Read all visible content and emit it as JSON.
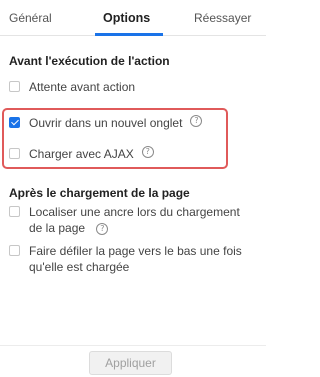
{
  "tabs": [
    {
      "label": "Général",
      "active": false
    },
    {
      "label": "Options",
      "active": true
    },
    {
      "label": "Réessayer",
      "active": false
    }
  ],
  "sections": {
    "before": {
      "title": "Avant l'exécution de l'action",
      "options": [
        {
          "label": "Attente avant action",
          "checked": false,
          "help": false
        },
        {
          "label": "Ouvrir dans un nouvel onglet",
          "checked": true,
          "help": true
        },
        {
          "label": "Charger avec AJAX",
          "checked": false,
          "help": true
        }
      ]
    },
    "after": {
      "title": "Après le chargement de la page",
      "options": [
        {
          "label_line1": "Localiser une ancre lors du chargement",
          "label_line2": "de la page",
          "checked": false,
          "help": true
        },
        {
          "label_line1": "Faire défiler la page vers le bas une fois",
          "label_line2": "qu'elle est chargée",
          "checked": false,
          "help": false
        }
      ]
    }
  },
  "help_icon_glyph": "?",
  "footer": {
    "apply_label": "Appliquer"
  },
  "colors": {
    "accent": "#1a73e8",
    "highlight_border": "#e05a5a",
    "disabled_text": "#a0a0a0"
  }
}
